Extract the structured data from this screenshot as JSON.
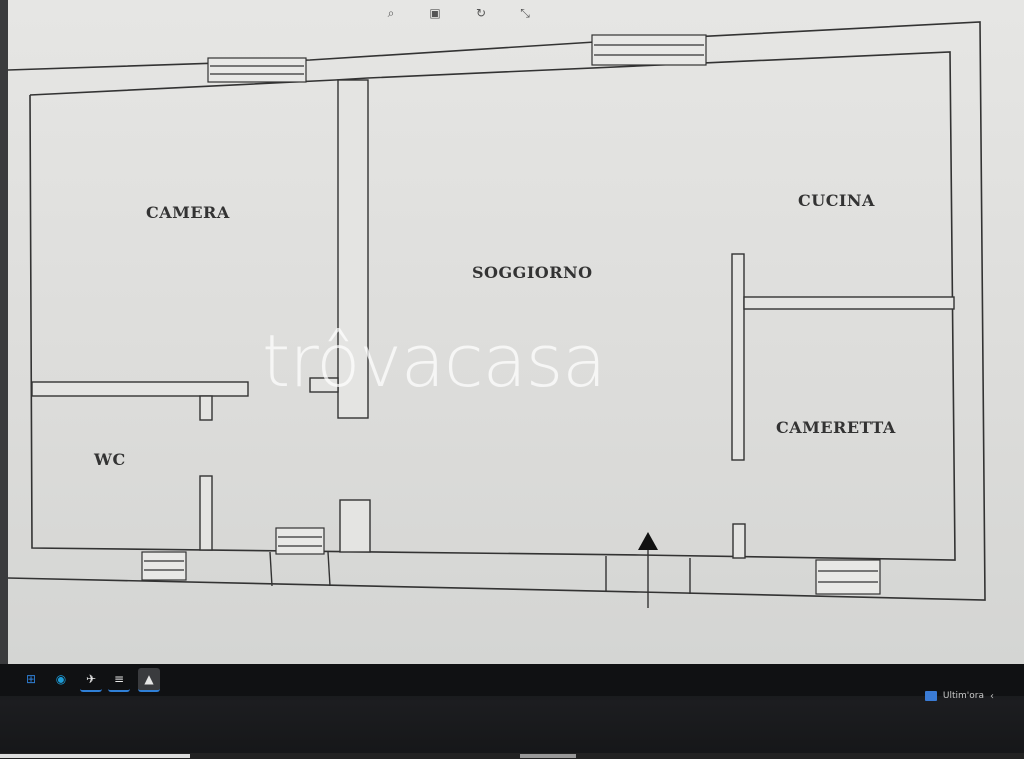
{
  "viewer": {
    "toolbar": [
      {
        "name": "zoom-icon",
        "glyph": "⌕"
      },
      {
        "name": "print-icon",
        "glyph": "▣"
      },
      {
        "name": "rotate-icon",
        "glyph": "↻"
      },
      {
        "name": "fit-icon",
        "glyph": "⤡"
      }
    ]
  },
  "plan": {
    "rooms": {
      "camera": "CAMERA",
      "soggiorno": "SOGGIORNO",
      "cucina": "CUCINA",
      "cameretta": "CAMERETTA",
      "wc": "WC"
    }
  },
  "watermark": "trôvacasa",
  "taskbar": {
    "icons": [
      {
        "name": "start-icon",
        "glyph": "⊞",
        "color": "#2f7fd6"
      },
      {
        "name": "edge-icon",
        "glyph": "◉",
        "color": "#1d9bd6"
      },
      {
        "name": "app-icon",
        "glyph": "✈",
        "color": "#4a4a4a"
      },
      {
        "name": "list-icon",
        "glyph": "≡",
        "color": "#4a4a4a"
      },
      {
        "name": "photos-icon",
        "glyph": "▲",
        "color": "#4a4a4a"
      }
    ],
    "tray_text": "Ultim'ora",
    "tray_caret": "‹"
  },
  "colors": {
    "wall": "#3a3a3a",
    "accent": "#2f7fd6"
  }
}
